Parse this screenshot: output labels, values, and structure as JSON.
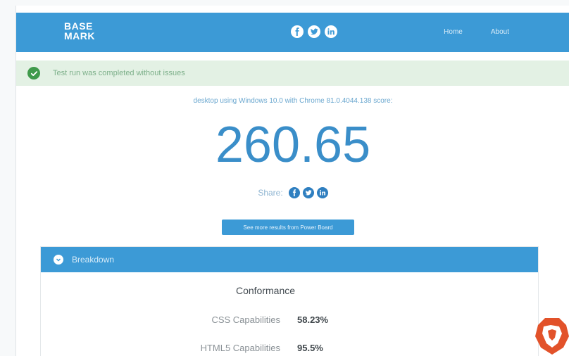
{
  "navbar": {
    "logo_line1": "BASE",
    "logo_line2": "MARK",
    "social_icons": [
      "facebook-icon",
      "twitter-icon",
      "linkedin-icon"
    ],
    "links": [
      "Home",
      "About"
    ]
  },
  "alert": {
    "icon": "check-circle-icon",
    "text": "Test run was completed without issues"
  },
  "score": {
    "caption": "desktop using Windows 10.0 with Chrome 81.0.4044.138 score:",
    "value": "260.65",
    "share_label": "Share:",
    "share_icons": [
      "facebook-icon",
      "twitter-icon",
      "linkedin-icon"
    ],
    "results_button": "See more results from Power Board"
  },
  "breakdown": {
    "title": "Breakdown",
    "section": "Conformance",
    "metrics": [
      {
        "label": "CSS Capabilities",
        "value": "58.23%"
      },
      {
        "label": "HTML5 Capabilities",
        "value": "95.5%"
      }
    ]
  },
  "colors": {
    "brand_blue": "#3c9ad6",
    "score_blue": "#3a8ec9",
    "success_green": "#3f9a4b",
    "alert_bg": "#e3f1e4"
  }
}
